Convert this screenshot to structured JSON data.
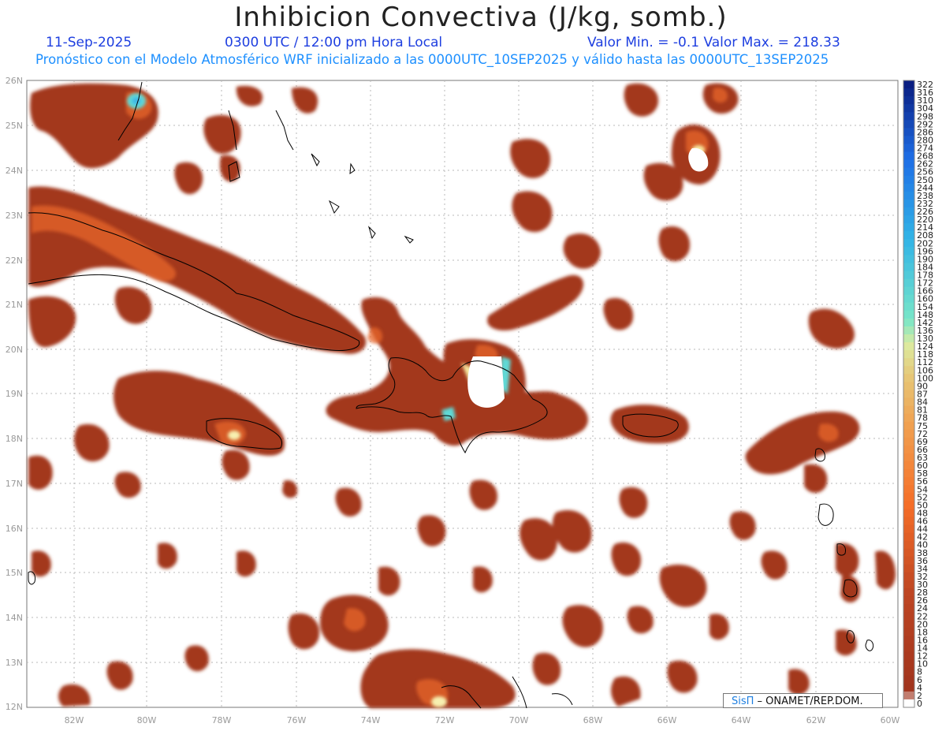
{
  "title": "Inhibicion Convectiva (J/kg, somb.)",
  "date": "11-Sep-2025",
  "time": "0300 UTC / 12:00 pm Hora Local",
  "stats": "Valor Min. = -0.1  Valor Max. = 218.33",
  "forecast": "Pronóstico con el Modelo Atmosférico WRF inicializado a las 0000UTC_10SEP2025 y válido hasta las  0000UTC_13SEP2025",
  "credit": {
    "brand": "SisΠ",
    "text": " – ONAMET/REP.DOM."
  },
  "lat_labels": [
    "26N",
    "25N",
    "24N",
    "23N",
    "22N",
    "21N",
    "20N",
    "19N",
    "18N",
    "17N",
    "16N",
    "15N",
    "14N",
    "13N",
    "12N"
  ],
  "lon_labels": [
    "82W",
    "80W",
    "78W",
    "76W",
    "74W",
    "72W",
    "70W",
    "68W",
    "66W",
    "64W",
    "62W",
    "60W"
  ],
  "colorbar": {
    "labels": [
      "322",
      "316",
      "310",
      "304",
      "298",
      "292",
      "286",
      "280",
      "274",
      "268",
      "262",
      "256",
      "250",
      "244",
      "238",
      "232",
      "226",
      "220",
      "214",
      "208",
      "202",
      "196",
      "190",
      "184",
      "178",
      "172",
      "166",
      "160",
      "154",
      "148",
      "142",
      "136",
      "130",
      "124",
      "118",
      "112",
      "106",
      "100",
      "90",
      "87",
      "84",
      "81",
      "78",
      "75",
      "72",
      "69",
      "66",
      "63",
      "60",
      "58",
      "56",
      "54",
      "52",
      "50",
      "48",
      "46",
      "44",
      "42",
      "40",
      "38",
      "36",
      "34",
      "32",
      "30",
      "28",
      "26",
      "24",
      "22",
      "20",
      "18",
      "16",
      "14",
      "12",
      "10",
      "8",
      "6",
      "4",
      "2",
      "0"
    ]
  },
  "colors": {
    "shade": "#a3371f",
    "high": "#f47c2d",
    "peak": "#ffe08a",
    "max": "#5fd9d6"
  }
}
